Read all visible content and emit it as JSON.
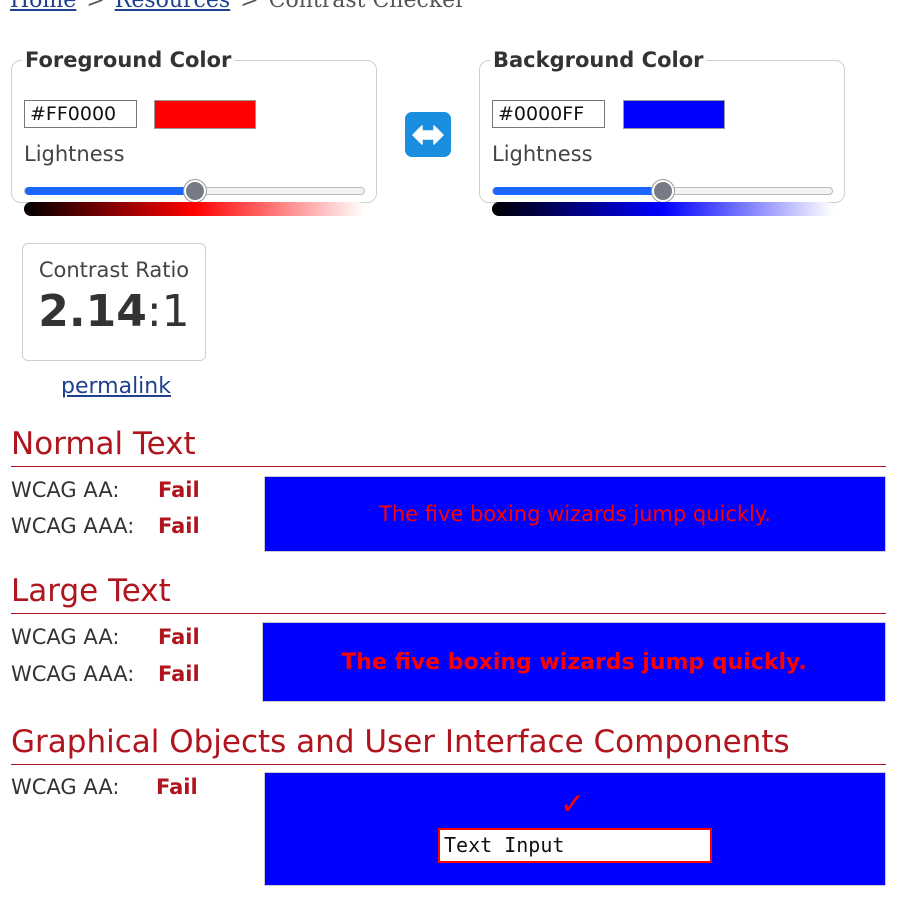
{
  "breadcrumb": {
    "home": "Home",
    "resources": "Resources",
    "current": "Contrast Checker",
    "separator": ">"
  },
  "foreground": {
    "legend": "Foreground Color",
    "hex": "#FF0000",
    "color": "#ff0000",
    "lightness_label": "Lightness",
    "lightness_percent": 50
  },
  "background": {
    "legend": "Background Color",
    "hex": "#0000FF",
    "color": "#0000ff",
    "lightness_label": "Lightness",
    "lightness_percent": 50
  },
  "swap": {
    "icon": "swap-arrows-icon"
  },
  "ratio": {
    "label": "Contrast Ratio",
    "value": "2.14",
    "suffix": ":1"
  },
  "permalink": "permalink",
  "normal_text": {
    "title": "Normal Text",
    "aa_label": "WCAG AA:",
    "aa_result": "Fail",
    "aaa_label": "WCAG AAA:",
    "aaa_result": "Fail",
    "sample": "The five boxing wizards jump quickly."
  },
  "large_text": {
    "title": "Large Text",
    "aa_label": "WCAG AA:",
    "aa_result": "Fail",
    "aaa_label": "WCAG AAA:",
    "aaa_result": "Fail",
    "sample": "The five boxing wizards jump quickly."
  },
  "graphics": {
    "title": "Graphical Objects and User Interface Components",
    "aa_label": "WCAG AA:",
    "aa_result": "Fail",
    "check_glyph": "✓",
    "input_value": "Text Input"
  },
  "colors": {
    "accent_red": "#b0141c",
    "link": "#1f3f8f",
    "slider_fill": "#1a66ff",
    "swap_button": "#1a8fe0"
  }
}
